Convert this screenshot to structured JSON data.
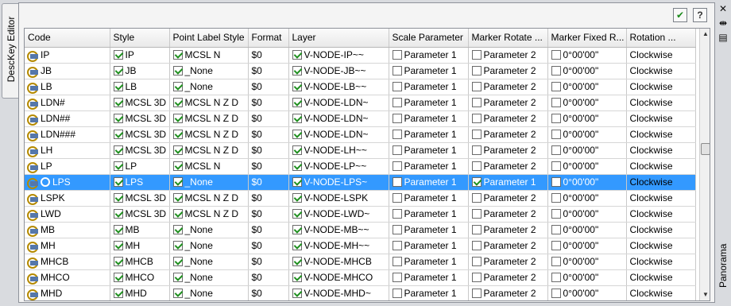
{
  "palette": {
    "left_tab": "DescKey Editor",
    "right_tab": "Panorama"
  },
  "toolbar": {
    "apply_icon": "checkmark-icon",
    "help_label": "?"
  },
  "grid": {
    "columns": [
      "Code",
      "Style",
      "Point Label Style",
      "Format",
      "Layer",
      "Scale Parameter",
      "Marker Rotate ...",
      "Marker Fixed R...",
      "Rotation ..."
    ],
    "rows": [
      {
        "code": "IP",
        "style": "IP",
        "pls": "MCSL N",
        "format": "$0",
        "layer": "V-NODE-IP~~",
        "scale": "Parameter 1",
        "rotate": "Parameter 2",
        "fixed": "0°00'00\"",
        "rotation": "Clockwise",
        "rot_checked": false
      },
      {
        "code": "JB",
        "style": "JB",
        "pls": "_None",
        "format": "$0",
        "layer": "V-NODE-JB~~",
        "scale": "Parameter 1",
        "rotate": "Parameter 2",
        "fixed": "0°00'00\"",
        "rotation": "Clockwise",
        "rot_checked": false
      },
      {
        "code": "LB",
        "style": "LB",
        "pls": "_None",
        "format": "$0",
        "layer": "V-NODE-LB~~",
        "scale": "Parameter 1",
        "rotate": "Parameter 2",
        "fixed": "0°00'00\"",
        "rotation": "Clockwise",
        "rot_checked": false
      },
      {
        "code": "LDN#",
        "style": "MCSL 3D",
        "pls": "MCSL N Z D",
        "format": "$0",
        "layer": "V-NODE-LDN~",
        "scale": "Parameter 1",
        "rotate": "Parameter 2",
        "fixed": "0°00'00\"",
        "rotation": "Clockwise",
        "rot_checked": false
      },
      {
        "code": "LDN##",
        "style": "MCSL 3D",
        "pls": "MCSL N Z D",
        "format": "$0",
        "layer": "V-NODE-LDN~",
        "scale": "Parameter 1",
        "rotate": "Parameter 2",
        "fixed": "0°00'00\"",
        "rotation": "Clockwise",
        "rot_checked": false
      },
      {
        "code": "LDN###",
        "style": "MCSL 3D",
        "pls": "MCSL N Z D",
        "format": "$0",
        "layer": "V-NODE-LDN~",
        "scale": "Parameter 1",
        "rotate": "Parameter 2",
        "fixed": "0°00'00\"",
        "rotation": "Clockwise",
        "rot_checked": false
      },
      {
        "code": "LH",
        "style": "MCSL 3D",
        "pls": "MCSL N Z D",
        "format": "$0",
        "layer": "V-NODE-LH~~",
        "scale": "Parameter 1",
        "rotate": "Parameter 2",
        "fixed": "0°00'00\"",
        "rotation": "Clockwise",
        "rot_checked": false
      },
      {
        "code": "LP",
        "style": "LP",
        "pls": "MCSL N",
        "format": "$0",
        "layer": "V-NODE-LP~~",
        "scale": "Parameter 1",
        "rotate": "Parameter 2",
        "fixed": "0°00'00\"",
        "rotation": "Clockwise",
        "rot_checked": false
      },
      {
        "code": "LPS",
        "style": "LPS",
        "pls": "_None",
        "format": "$0",
        "layer": "V-NODE-LPS~",
        "scale": "Parameter 1",
        "rotate": "Parameter 1",
        "fixed": "0°00'00\"",
        "rotation": "Clockwise",
        "rot_checked": true,
        "selected": true
      },
      {
        "code": "LSPK",
        "style": "MCSL 3D",
        "pls": "MCSL N Z D",
        "format": "$0",
        "layer": "V-NODE-LSPK",
        "scale": "Parameter 1",
        "rotate": "Parameter 2",
        "fixed": "0°00'00\"",
        "rotation": "Clockwise",
        "rot_checked": false
      },
      {
        "code": "LWD",
        "style": "MCSL 3D",
        "pls": "MCSL N Z D",
        "format": "$0",
        "layer": "V-NODE-LWD~",
        "scale": "Parameter 1",
        "rotate": "Parameter 2",
        "fixed": "0°00'00\"",
        "rotation": "Clockwise",
        "rot_checked": false
      },
      {
        "code": "MB",
        "style": "MB",
        "pls": "_None",
        "format": "$0",
        "layer": "V-NODE-MB~~",
        "scale": "Parameter 1",
        "rotate": "Parameter 2",
        "fixed": "0°00'00\"",
        "rotation": "Clockwise",
        "rot_checked": false
      },
      {
        "code": "MH",
        "style": "MH",
        "pls": "_None",
        "format": "$0",
        "layer": "V-NODE-MH~~",
        "scale": "Parameter 1",
        "rotate": "Parameter 2",
        "fixed": "0°00'00\"",
        "rotation": "Clockwise",
        "rot_checked": false
      },
      {
        "code": "MHCB",
        "style": "MHCB",
        "pls": "_None",
        "format": "$0",
        "layer": "V-NODE-MHCB",
        "scale": "Parameter 1",
        "rotate": "Parameter 2",
        "fixed": "0°00'00\"",
        "rotation": "Clockwise",
        "rot_checked": false
      },
      {
        "code": "MHCO",
        "style": "MHCO",
        "pls": "_None",
        "format": "$0",
        "layer": "V-NODE-MHCO",
        "scale": "Parameter 1",
        "rotate": "Parameter 2",
        "fixed": "0°00'00\"",
        "rotation": "Clockwise",
        "rot_checked": false
      },
      {
        "code": "MHD",
        "style": "MHD",
        "pls": "_None",
        "format": "$0",
        "layer": "V-NODE-MHD~",
        "scale": "Parameter 1",
        "rotate": "Parameter 2",
        "fixed": "0°00'00\"",
        "rotation": "Clockwise",
        "rot_checked": false
      }
    ]
  },
  "colors": {
    "selection": "#3399ff",
    "check": "#1f8f1f"
  }
}
